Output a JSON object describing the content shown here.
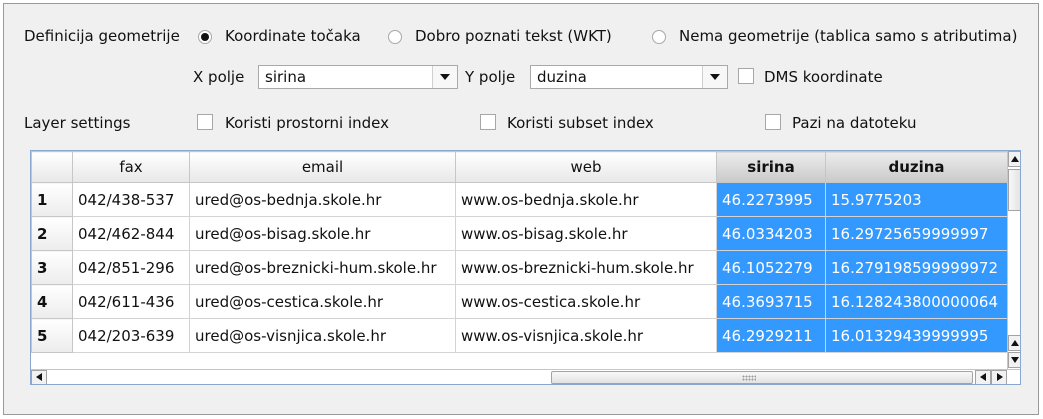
{
  "geometry": {
    "label": "Definicija geometrije",
    "options": [
      {
        "label": "Koordinate točaka",
        "selected": true
      },
      {
        "label": "Dobro poznati tekst (WKT)",
        "selected": false
      },
      {
        "label": "Nema geometrije (tablica samo s atributima)",
        "selected": false
      }
    ]
  },
  "fields": {
    "x_label": "X polje",
    "x_value": "sirina",
    "y_label": "Y polje",
    "y_value": "duzina",
    "dms_label": "DMS koordinate",
    "dms_checked": false
  },
  "layer_settings": {
    "label": "Layer settings",
    "spatial_index": "Koristi prostorni index",
    "subset_index": "Koristi subset index",
    "watch_file": "Pazi na datoteku"
  },
  "table": {
    "columns": [
      "fax",
      "email",
      "web",
      "sirina",
      "duzina"
    ],
    "selected_columns": [
      "sirina",
      "duzina"
    ],
    "rows": [
      {
        "n": "1",
        "fax": "042/438-537",
        "email": "ured@os-bednja.skole.hr",
        "web": "www.os-bednja.skole.hr",
        "sirina": "46.2273995",
        "duzina": "15.9775203"
      },
      {
        "n": "2",
        "fax": "042/462-844",
        "email": "ured@os-bisag.skole.hr",
        "web": "www.os-bisag.skole.hr",
        "sirina": "46.0334203",
        "duzina": "16.29725659999997"
      },
      {
        "n": "3",
        "fax": "042/851-296",
        "email": "ured@os-breznicki-hum.skole.hr",
        "web": "www.os-breznicki-hum.skole.hr",
        "sirina": "46.1052279",
        "duzina": "16.279198599999972"
      },
      {
        "n": "4",
        "fax": "042/611-436",
        "email": "ured@os-cestica.skole.hr",
        "web": "www.os-cestica.skole.hr",
        "sirina": "46.3693715",
        "duzina": "16.128243800000064"
      },
      {
        "n": "5",
        "fax": "042/203-639",
        "email": "ured@os-visnjica.skole.hr",
        "web": "www.os-visnjica.skole.hr",
        "sirina": "46.2929211",
        "duzina": "16.01329439999995"
      }
    ]
  },
  "colors": {
    "selection": "#3399ff",
    "panel": "#f0f0f0"
  }
}
